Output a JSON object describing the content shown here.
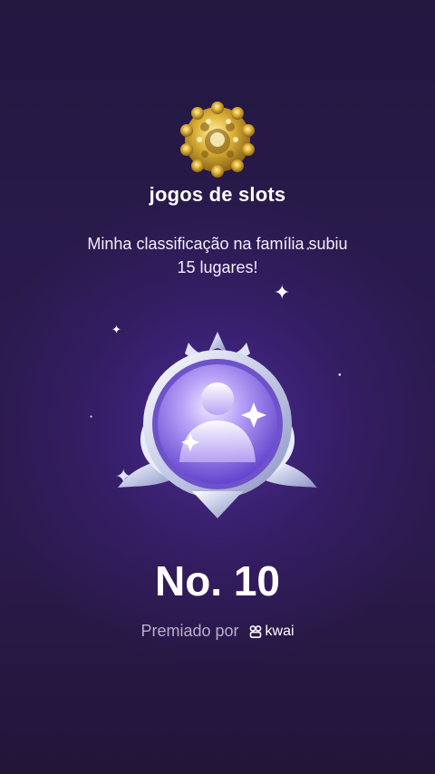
{
  "family": {
    "name": "jogos de slots",
    "emblem_icon": "gold-coin-emblem-icon"
  },
  "message": {
    "line1": "Minha classificação na família subiu",
    "line2": "15 lugares!"
  },
  "badge": {
    "icon": "silver-rank-badge-icon"
  },
  "rank": {
    "text": "No. 10"
  },
  "awarded": {
    "label": "Premiado por",
    "brand": "kwai",
    "brand_icon": "kwai-logo-icon"
  },
  "colors": {
    "background": "#2a1a4d",
    "badge_purple": "#8a6ae8",
    "subtext": "#b9aed0"
  }
}
